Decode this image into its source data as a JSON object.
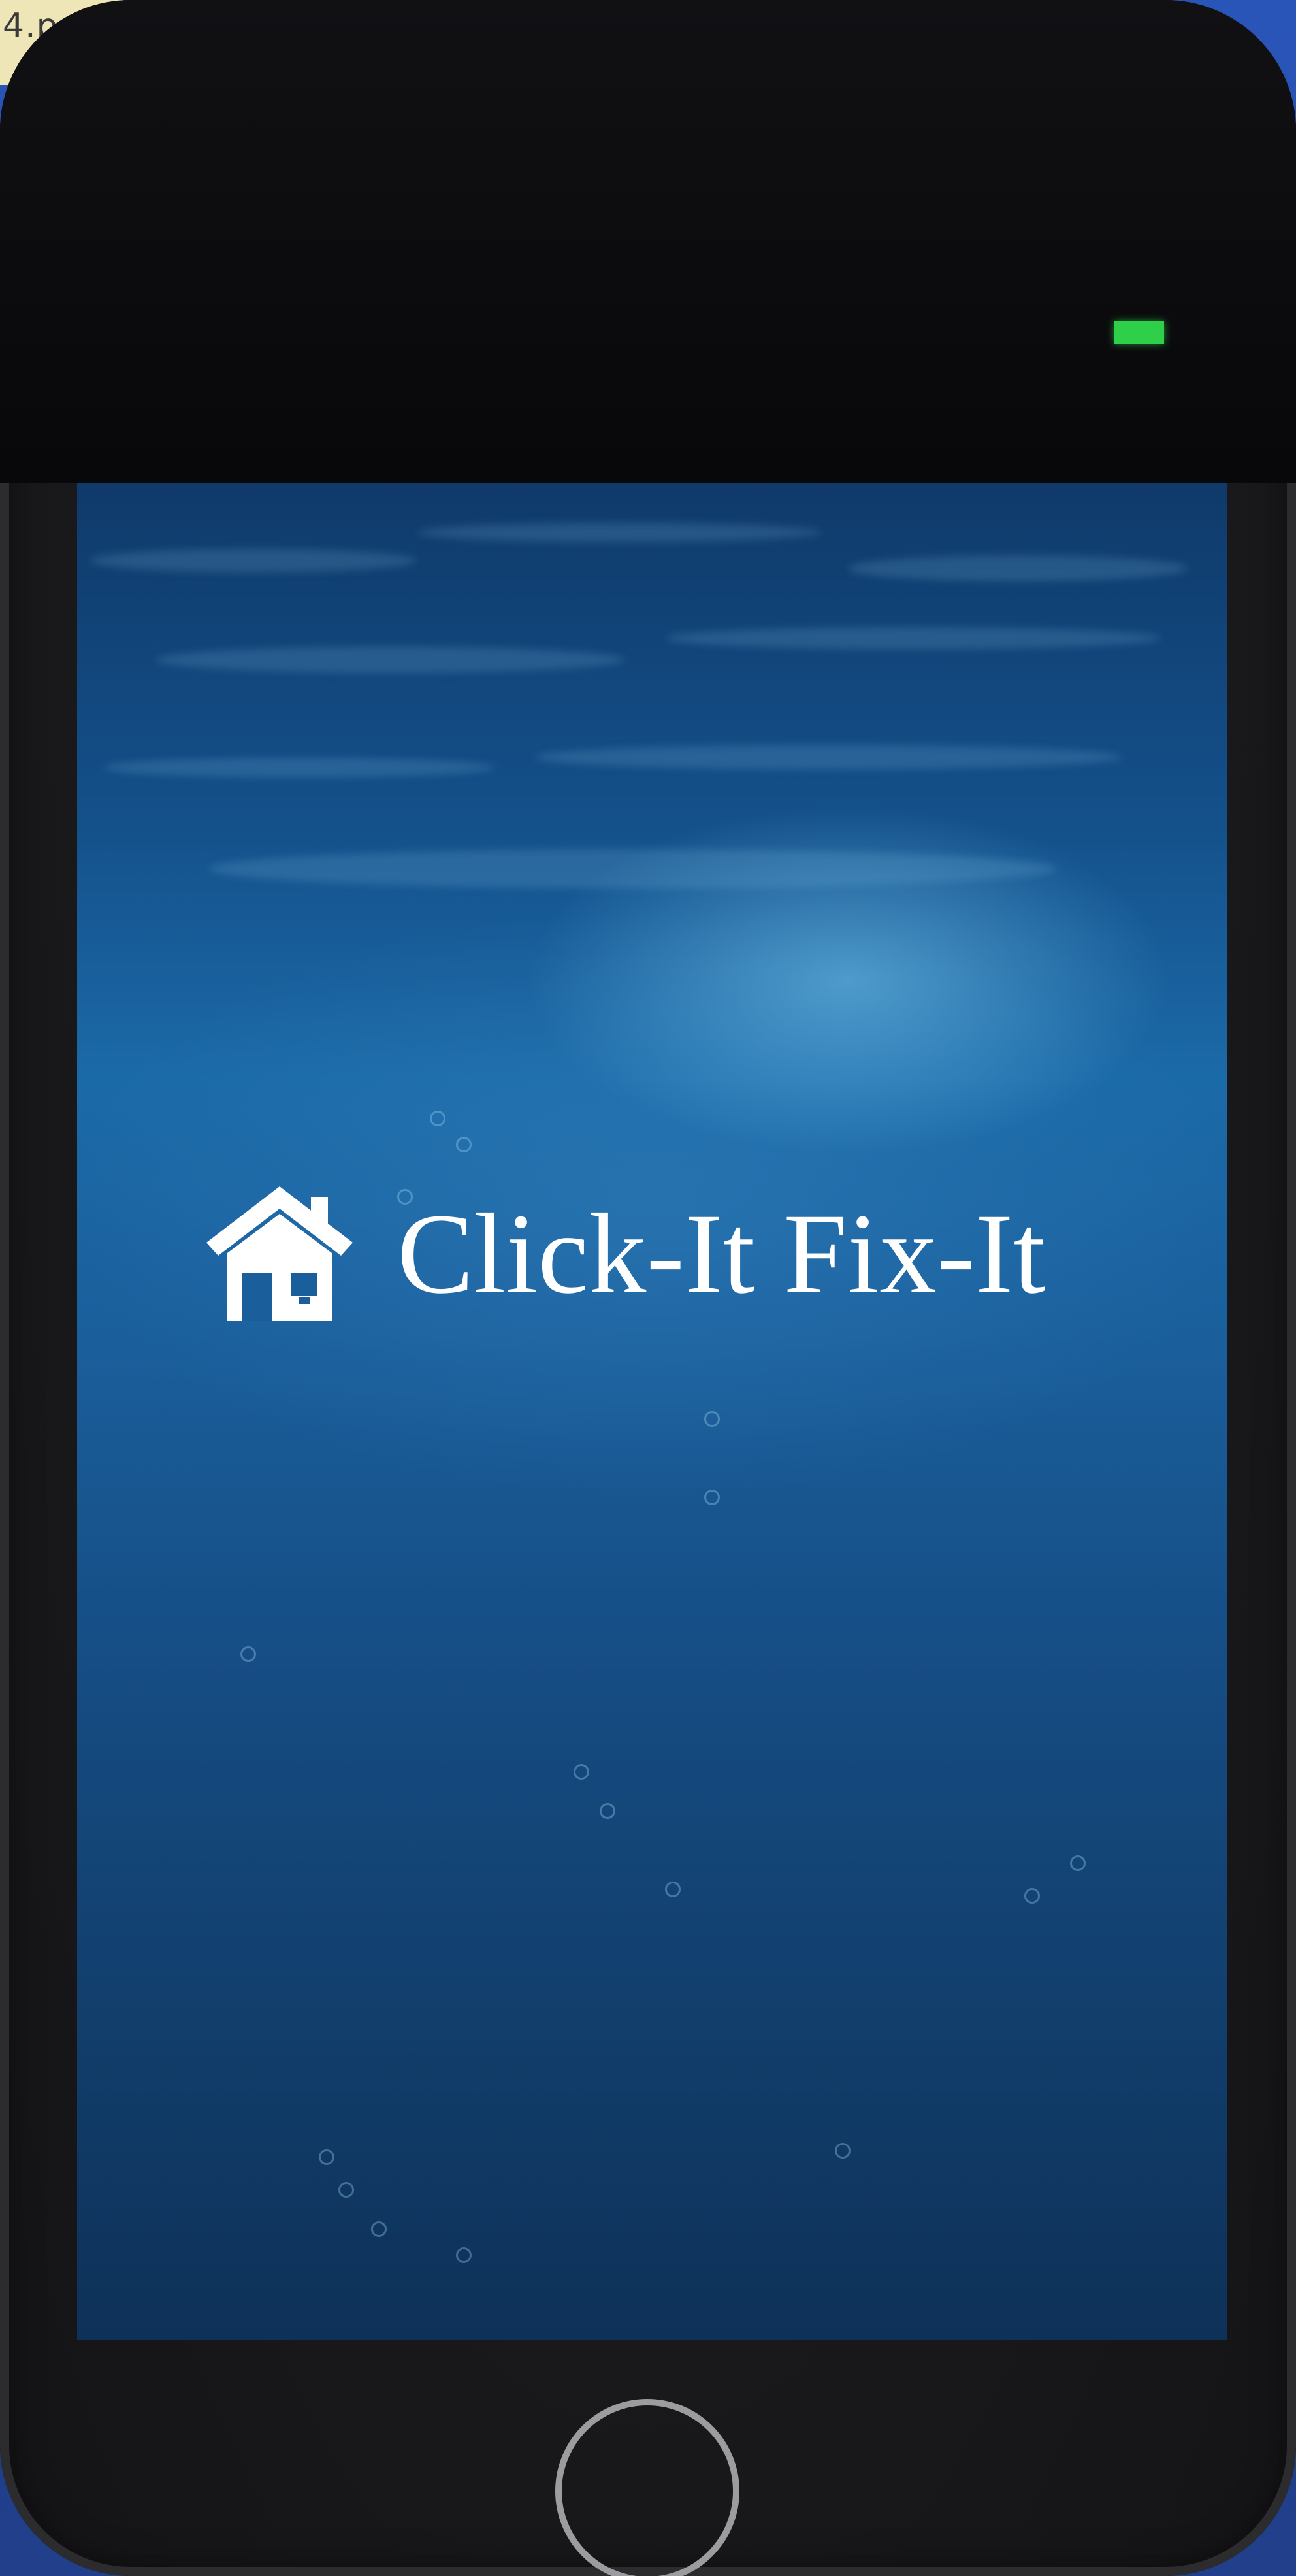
{
  "desk": {
    "corner_label": "4.p"
  },
  "phone": {
    "status_led_color": "#2ed04a"
  },
  "splash": {
    "icon": "home-icon",
    "title": "Click-It Fix-It",
    "title_color": "#ffffff"
  },
  "hardware": {
    "home_button": "home-button"
  }
}
